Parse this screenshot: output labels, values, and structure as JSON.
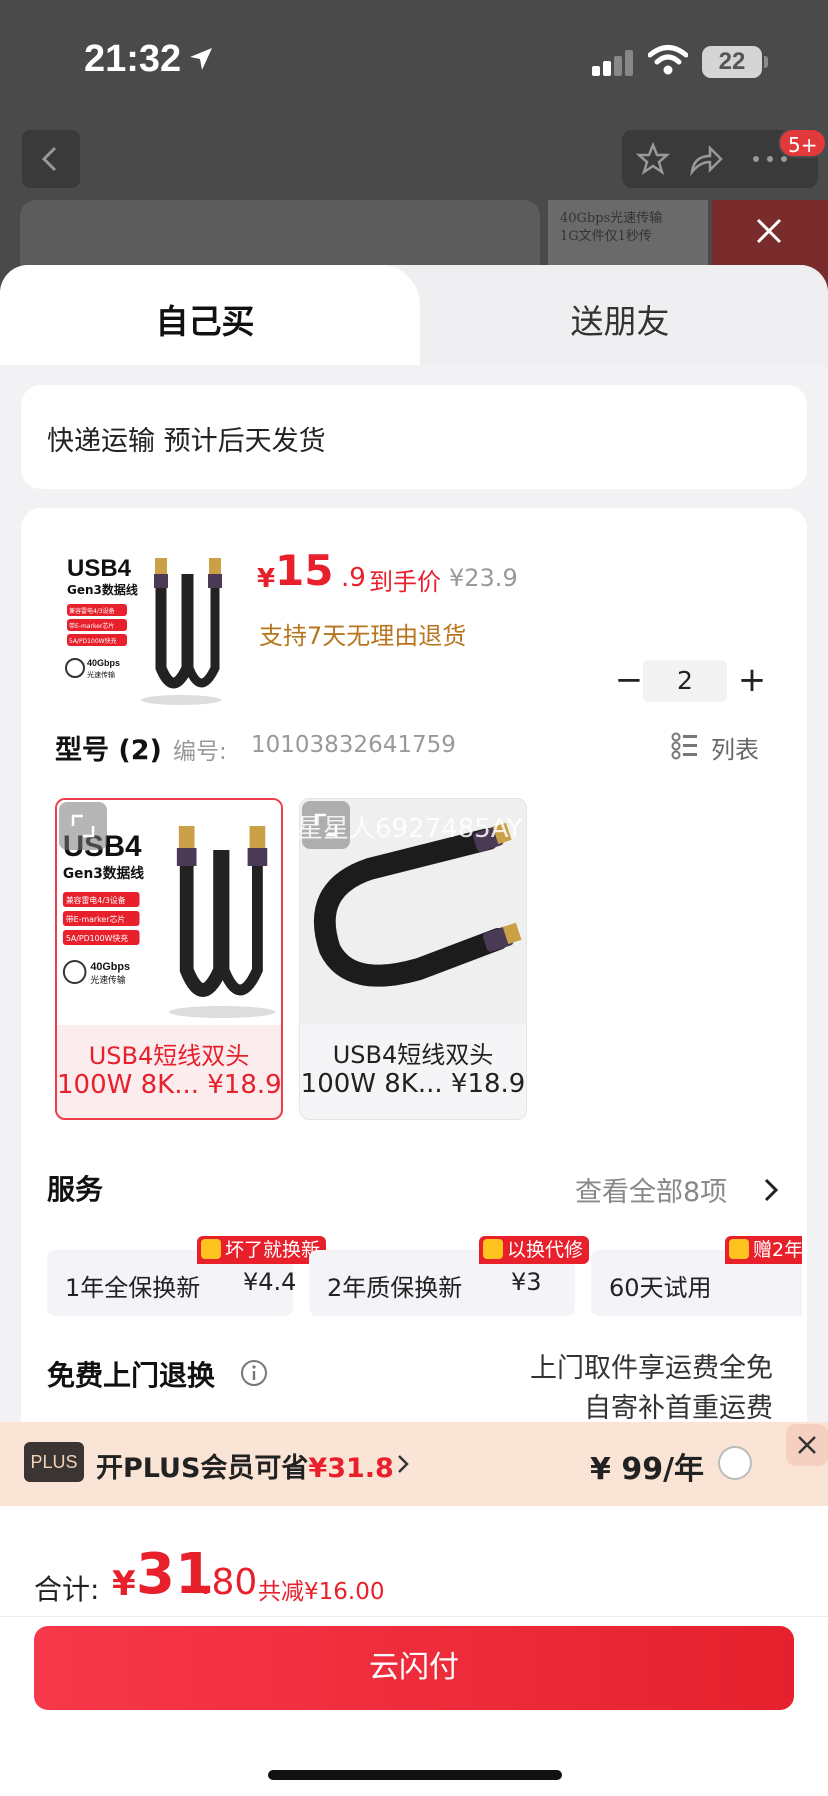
{
  "status_bar": {
    "time": "21:32",
    "battery": "22"
  },
  "nav": {
    "badge": "5+"
  },
  "background_banner": {
    "line1": "40Gbps光速传输",
    "line2": "1G文件仅1秒传"
  },
  "tabs": [
    {
      "label": "自己买"
    },
    {
      "label": "送朋友"
    }
  ],
  "delivery": {
    "text": "快递运输 预计后天发货"
  },
  "product": {
    "price_symbol": "¥",
    "price_int": "15",
    "price_dec": ".9",
    "price_tag": "到手价",
    "original_price": "¥23.9",
    "return_note": "支持7天无理由退货",
    "quantity": "2",
    "minus": "−",
    "plus": "+",
    "thumb_text": {
      "brand": "USB4",
      "sub": "Gen3数据线",
      "tag1": "兼容雷电4/3设备",
      "tag2": "带E-marker芯片",
      "tag3": "5A/PD100W快充",
      "speed": "40Gbps",
      "speed_sub": "光速传输"
    }
  },
  "model": {
    "title": "型号 (2)",
    "code_label": "编号:",
    "code": "10103832641759",
    "list_label": "列表",
    "variants": [
      {
        "name": "USB4短线双头",
        "sub": "100W 8K...",
        "price": "¥18.9",
        "selected": true
      },
      {
        "name": "USB4短线双头",
        "sub": "100W 8K...",
        "price": "¥18.9",
        "selected": false
      }
    ],
    "watermark": "星星人6927485AY"
  },
  "services": {
    "title": "服务",
    "view_all": "查看全部8项",
    "items": [
      {
        "label": "1年全保换新",
        "price": "¥4.4",
        "badge": "坏了就换新"
      },
      {
        "label": "2年质保换新",
        "price": "¥3",
        "badge": "以换代修"
      },
      {
        "label": "60天试用",
        "price": "",
        "badge": "赠2年"
      }
    ]
  },
  "free_return": {
    "title": "免费上门退换",
    "line1": "上门取件享运费全免",
    "line2": "自寄补首重运费"
  },
  "plus": {
    "logo": "PLUS",
    "text": "开PLUS会员可省",
    "save": "¥31.8",
    "price": "¥ 99/年"
  },
  "total": {
    "label": "合计:",
    "symbol": "¥",
    "int": "31",
    "dec": ".80",
    "reduce": "共减¥16.00"
  },
  "pay_button": "云闪付",
  "colors": {
    "accent": "#e8202c",
    "pay": "#f0303e",
    "plus_bg": "#fae4d6",
    "gold": "#b8751f"
  }
}
